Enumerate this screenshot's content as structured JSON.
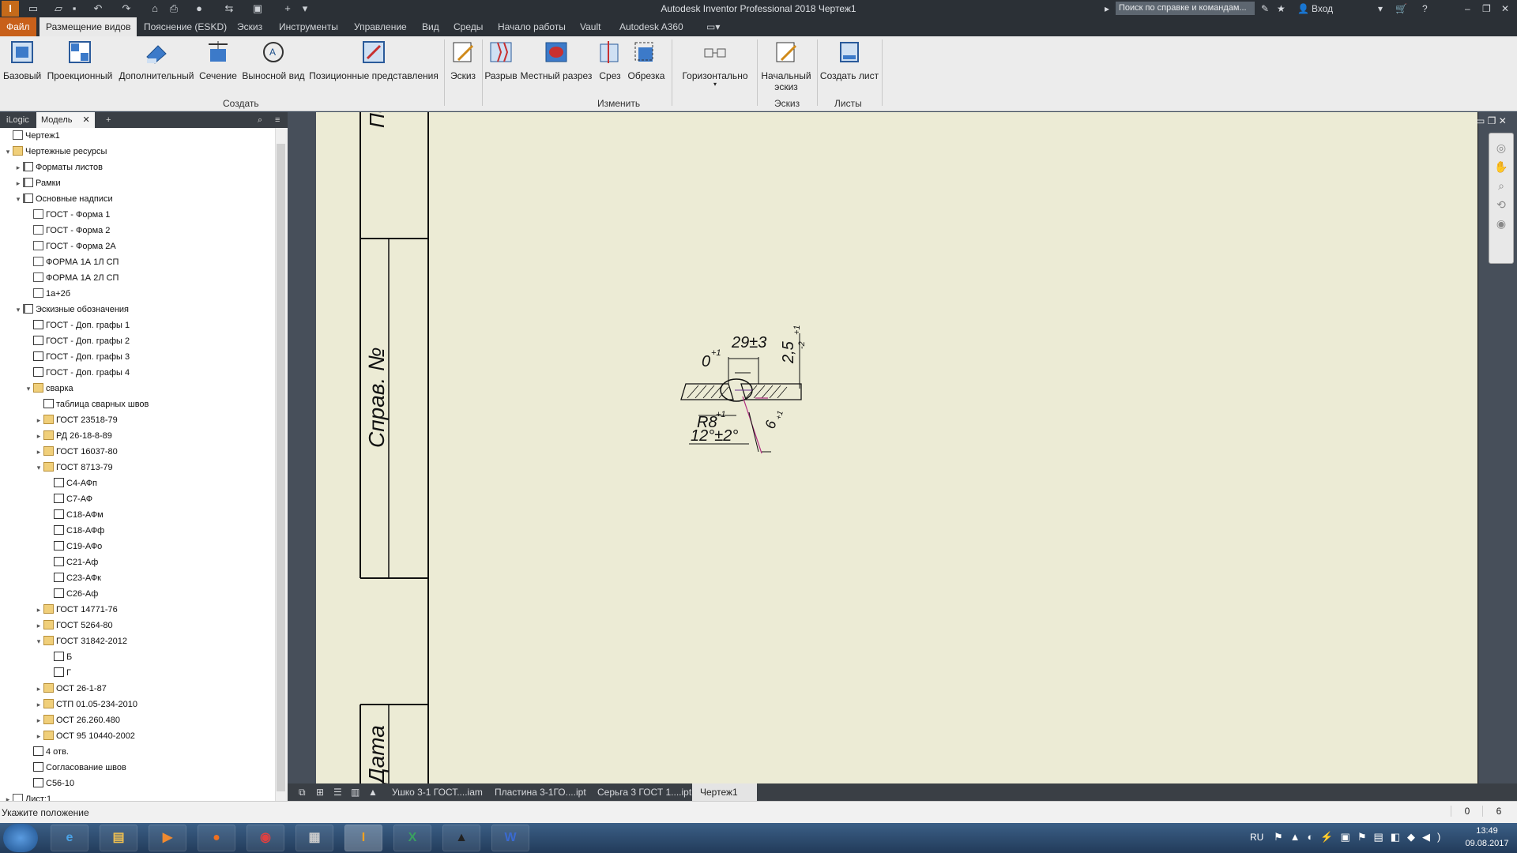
{
  "titlebar": {
    "app_title": "Autodesk Inventor Professional 2018   Чертеж1",
    "search_placeholder": "Поиск по справке и командам...",
    "signin": "Вход"
  },
  "menu": {
    "tabs": [
      "Файл",
      "Размещение видов",
      "Пояснение (ESKD)",
      "Эскиз",
      "Инструменты",
      "Управление",
      "Вид",
      "Среды",
      "Начало работы",
      "Vault",
      "Autodesk A360"
    ],
    "active_index": 1
  },
  "ribbon": {
    "create_buttons": [
      "Базовый",
      "Проекционный",
      "Дополнительный",
      "Сечение",
      "Выносной вид",
      "Позиционные представления"
    ],
    "sketch_button": "Эскиз",
    "modify_buttons": [
      "Разрыв",
      "Местный разрез",
      "Срез",
      "Обрезка"
    ],
    "horizontal_button": "Горизонтально",
    "start_sketch_line1": "Начальный",
    "start_sketch_line2": "эскиз",
    "create_sheet_button": "Создать лист",
    "groups": [
      "Создать",
      "Изменить",
      "Эскиз",
      "Листы"
    ]
  },
  "browser": {
    "tabs": [
      "iLogic",
      "Модель"
    ],
    "tree": [
      {
        "label": "Чертеж1",
        "level": 0,
        "exp": "",
        "icon": "doc"
      },
      {
        "label": "Чертежные ресурсы",
        "level": 0,
        "exp": "v",
        "icon": "folder"
      },
      {
        "label": "Форматы листов",
        "level": 1,
        "exp": ">",
        "icon": "res"
      },
      {
        "label": "Рамки",
        "level": 1,
        "exp": ">",
        "icon": "res"
      },
      {
        "label": "Основные надписи",
        "level": 1,
        "exp": "v",
        "icon": "res"
      },
      {
        "label": "ГОСТ - Форма 1",
        "level": 2,
        "exp": "",
        "icon": "doc"
      },
      {
        "label": "ГОСТ - Форма 2",
        "level": 2,
        "exp": "",
        "icon": "doc"
      },
      {
        "label": "ГОСТ - Форма 2А",
        "level": 2,
        "exp": "",
        "icon": "doc"
      },
      {
        "label": "ФОРМА 1А 1Л СП",
        "level": 2,
        "exp": "",
        "icon": "doc"
      },
      {
        "label": "ФОРМА 1А 2Л СП",
        "level": 2,
        "exp": "",
        "icon": "doc"
      },
      {
        "label": "1а+2б",
        "level": 2,
        "exp": "",
        "icon": "doc"
      },
      {
        "label": "Эскизные обозначения",
        "level": 1,
        "exp": "v",
        "icon": "res"
      },
      {
        "label": "ГОСТ - Доп. графы 1",
        "level": 2,
        "exp": "",
        "icon": "sketch"
      },
      {
        "label": "ГОСТ - Доп. графы 2",
        "level": 2,
        "exp": "",
        "icon": "sketch"
      },
      {
        "label": "ГОСТ - Доп. графы 3",
        "level": 2,
        "exp": "",
        "icon": "sketch"
      },
      {
        "label": "ГОСТ - Доп. графы 4",
        "level": 2,
        "exp": "",
        "icon": "sketch"
      },
      {
        "label": "сварка",
        "level": 2,
        "exp": "v",
        "icon": "folder"
      },
      {
        "label": "таблица сварных швов",
        "level": 3,
        "exp": "",
        "icon": "sketch"
      },
      {
        "label": "ГОСТ 23518-79",
        "level": 3,
        "exp": ">",
        "icon": "folder"
      },
      {
        "label": "РД 26-18-8-89",
        "level": 3,
        "exp": ">",
        "icon": "folder"
      },
      {
        "label": "ГОСТ 16037-80",
        "level": 3,
        "exp": ">",
        "icon": "folder"
      },
      {
        "label": "ГОСТ 8713-79",
        "level": 3,
        "exp": "v",
        "icon": "folder"
      },
      {
        "label": "С4-АФп",
        "level": 4,
        "exp": "",
        "icon": "sketch"
      },
      {
        "label": "С7-АФ",
        "level": 4,
        "exp": "",
        "icon": "sketch"
      },
      {
        "label": "С18-АФм",
        "level": 4,
        "exp": "",
        "icon": "sketch"
      },
      {
        "label": "С18-АФф",
        "level": 4,
        "exp": "",
        "icon": "sketch"
      },
      {
        "label": "С19-АФо",
        "level": 4,
        "exp": "",
        "icon": "sketch"
      },
      {
        "label": "С21-Аф",
        "level": 4,
        "exp": "",
        "icon": "sketch"
      },
      {
        "label": "С23-АФк",
        "level": 4,
        "exp": "",
        "icon": "sketch"
      },
      {
        "label": "С26-Аф",
        "level": 4,
        "exp": "",
        "icon": "sketch"
      },
      {
        "label": "ГОСТ 14771-76",
        "level": 3,
        "exp": ">",
        "icon": "folder"
      },
      {
        "label": "ГОСТ 5264-80",
        "level": 3,
        "exp": ">",
        "icon": "folder"
      },
      {
        "label": "ГОСТ 31842-2012",
        "level": 3,
        "exp": "v",
        "icon": "folder"
      },
      {
        "label": "Б",
        "level": 4,
        "exp": "",
        "icon": "sketch"
      },
      {
        "label": "Г",
        "level": 4,
        "exp": "",
        "icon": "sketch"
      },
      {
        "label": "ОСТ 26-1-87",
        "level": 3,
        "exp": ">",
        "icon": "folder"
      },
      {
        "label": "СТП 01.05-234-2010",
        "level": 3,
        "exp": ">",
        "icon": "folder"
      },
      {
        "label": "ОСТ 26.260.480",
        "level": 3,
        "exp": ">",
        "icon": "folder"
      },
      {
        "label": "ОСТ 95 10440-2002",
        "level": 3,
        "exp": ">",
        "icon": "folder"
      },
      {
        "label": "4 отв.",
        "level": 2,
        "exp": "",
        "icon": "sketch"
      },
      {
        "label": "Согласование швов",
        "level": 2,
        "exp": "",
        "icon": "sketch"
      },
      {
        "label": "С56-10",
        "level": 2,
        "exp": "",
        "icon": "sketch"
      },
      {
        "label": "Лист:1",
        "level": 0,
        "exp": ">",
        "icon": "doc"
      }
    ]
  },
  "drawing": {
    "title_block_text_1": "Пе",
    "title_block_text_2": "Справ. №",
    "title_block_text_3": "Дата",
    "dim_29": "29±3",
    "dim_0": "0",
    "dim_0_sup": "+1",
    "dim_25": "2,5",
    "dim_25_sup": "+1",
    "dim_25_sub": "-2",
    "dim_r8": "R8",
    "dim_r8_sup": "+1",
    "dim_6": "6",
    "dim_6_sup": "+1",
    "dim_angle": "12°±2°"
  },
  "doc_tabs": [
    "Ушко 3-1 ГОСТ....iam",
    "Пластина 3-1ГО....ipt",
    "Серьга 3 ГОСТ 1....ipt",
    "Чертеж1"
  ],
  "active_doc_index": 3,
  "status": {
    "text": "Укажите положение",
    "num1": "0",
    "num2": "6"
  },
  "taskbar": {
    "lang": "RU",
    "time": "13:49",
    "date": "09.08.2017",
    "apps": [
      "ie-icon",
      "explorer-icon",
      "media-player-icon",
      "firefox-icon",
      "chrome-icon",
      "calculator-icon",
      "inventor-icon",
      "excel-icon",
      "hat-icon",
      "word-icon"
    ]
  },
  "colors": {
    "file_tab": "#c8601a",
    "sheet": "#ecebd5",
    "chrome_dark": "#2b3036"
  }
}
